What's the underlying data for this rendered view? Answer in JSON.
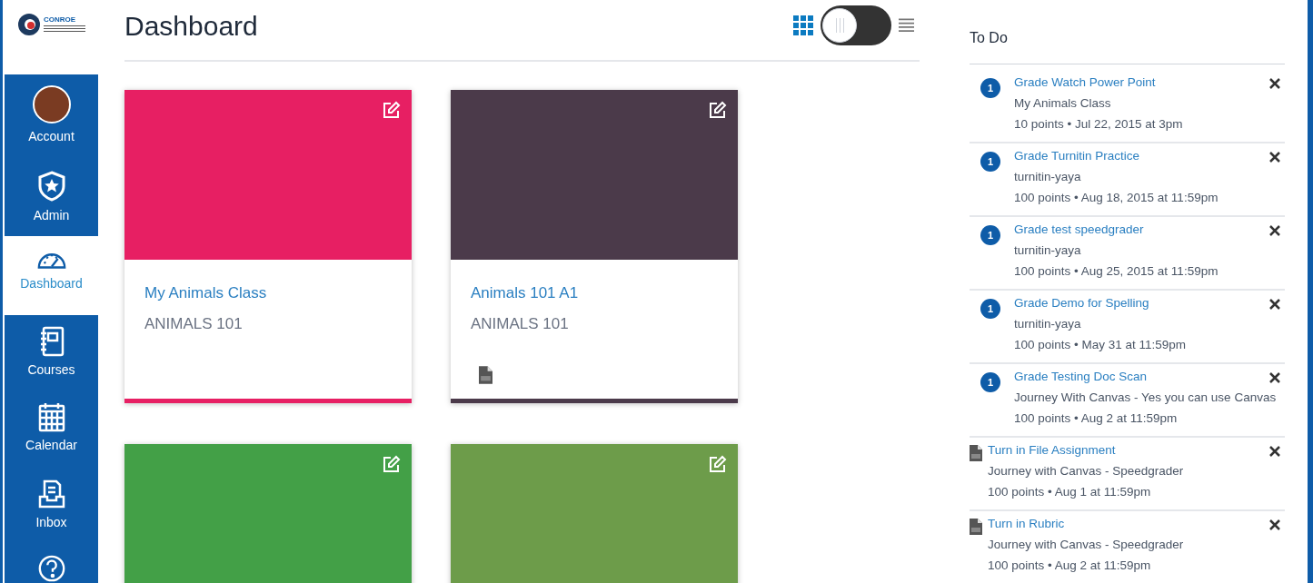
{
  "logo": {
    "text": "CONROE"
  },
  "nav": [
    {
      "label": "Account",
      "kind": "account",
      "selected": false
    },
    {
      "label": "Admin",
      "kind": "admin",
      "selected": false
    },
    {
      "label": "Dashboard",
      "kind": "dashboard",
      "selected": true
    },
    {
      "label": "Courses",
      "kind": "courses",
      "selected": false
    },
    {
      "label": "Calendar",
      "kind": "calendar",
      "selected": false
    },
    {
      "label": "Inbox",
      "kind": "inbox",
      "selected": false
    },
    {
      "kind": "help",
      "selected": false
    }
  ],
  "header": {
    "title": "Dashboard",
    "view_modes": [
      {
        "kind": "grid",
        "selected": true
      },
      {
        "kind": "list",
        "selected": false
      }
    ]
  },
  "cards": [
    {
      "title": "My Animals Class",
      "subtitle": "ANIMALS 101",
      "color": "#e71f63",
      "assignment_icon": false
    },
    {
      "title": "Animals 101 A1",
      "subtitle": "ANIMALS 101",
      "color": "#4b3a4a",
      "assignment_icon": true
    },
    {
      "color": "#43a047"
    },
    {
      "color": "#6d9c4a"
    }
  ],
  "todo": {
    "title": "To Do",
    "items": [
      {
        "kind": "grade",
        "badge": "1",
        "title": "Grade Watch Power Point",
        "course": "My Animals Class",
        "details": "10 points • Jul 22, 2015 at 3pm"
      },
      {
        "kind": "grade",
        "badge": "1",
        "title": "Grade Turnitin Practice",
        "course": "turnitin-yaya",
        "details": "100 points • Aug 18, 2015 at 11:59pm"
      },
      {
        "kind": "grade",
        "badge": "1",
        "title": "Grade test speedgrader",
        "course": "turnitin-yaya",
        "details": "100 points • Aug 25, 2015 at 11:59pm"
      },
      {
        "kind": "grade",
        "badge": "1",
        "title": "Grade Demo for Spelling",
        "course": "turnitin-yaya",
        "details": "100 points • May 31 at 11:59pm"
      },
      {
        "kind": "grade",
        "badge": "1",
        "title": "Grade Testing Doc Scan",
        "course": "Journey With Canvas - Yes you can use Canvas",
        "details": "100 points • Aug 2 at 11:59pm"
      },
      {
        "kind": "assignment",
        "title": "Turn in File Assignment",
        "course": "Journey with Canvas - Speedgrader",
        "details": "100 points • Aug 1 at 11:59pm"
      },
      {
        "kind": "assignment",
        "title": "Turn in Rubric",
        "course": "Journey with Canvas - Speedgrader",
        "details": "100 points • Aug 2 at 11:59pm"
      }
    ]
  }
}
